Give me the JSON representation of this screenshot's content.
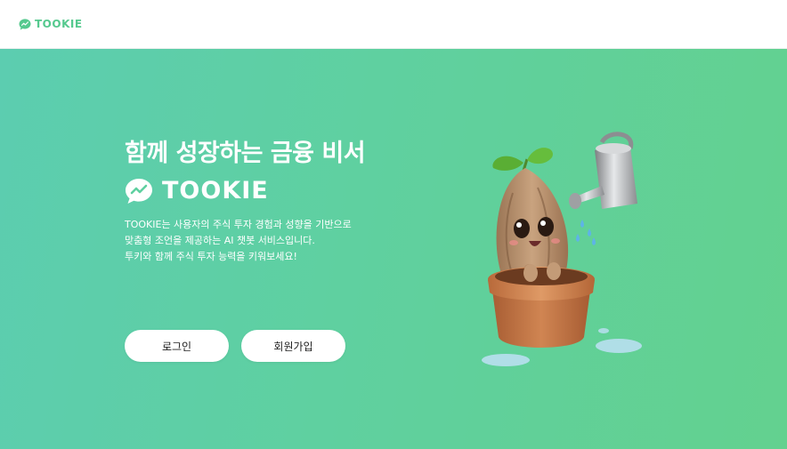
{
  "header": {
    "brand_name": "TOOKIE"
  },
  "hero": {
    "title": "함께 성장하는 금융 비서",
    "brand_name": "TOOKIE",
    "description": [
      "TOOKIE는 사용자의 주식 투자 경험과 성향을 기반으로",
      "맞춤형 조언을 제공하는 AI 챗봇 서비스입니다.",
      "투키와 함께 주식 투자 능력을 키워보세요!"
    ],
    "buttons": {
      "login_label": "로그인",
      "signup_label": "회원가입"
    }
  },
  "colors": {
    "brand": "#55c98e",
    "hero_gradient_start": "#5ccdb0",
    "hero_gradient_end": "#63d18f",
    "button_bg": "#ffffff"
  },
  "icons": {
    "brand": "chat-bubble-chart-icon",
    "mascot": "seed-sprout-in-pot-illustration"
  }
}
